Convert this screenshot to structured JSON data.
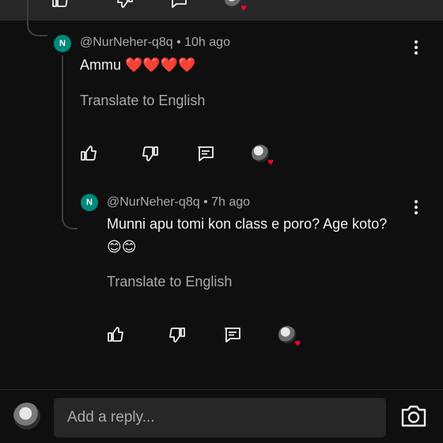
{
  "comments": [
    {
      "avatar_letter": "N",
      "author": "@NurNeher-q8q",
      "time": "10h ago",
      "text": "Ammu ❤️❤️❤️❤️",
      "translate_label": "Translate to English"
    },
    {
      "avatar_letter": "N",
      "author": "@NurNeher-q8q",
      "time": "7h ago",
      "text": "Munni apu tomi kon class e poro? Age koto?",
      "text_line2": "😊😊",
      "translate_label": "Translate to English"
    }
  ],
  "separator": " • ",
  "reply_bar": {
    "placeholder": "Add a reply..."
  },
  "icons": {
    "like": "thumb-up-icon",
    "dislike": "thumb-down-icon",
    "reply": "reply-comment-icon",
    "creator_heart": "creator-heart-icon",
    "more": "more-vert-icon",
    "camera": "camera-icon"
  },
  "colors": {
    "background": "#0f0f0f",
    "surface": "#272727",
    "secondary_text": "#aaaaaa",
    "avatar_teal": "#00897b",
    "heart_red": "#ff0033"
  }
}
